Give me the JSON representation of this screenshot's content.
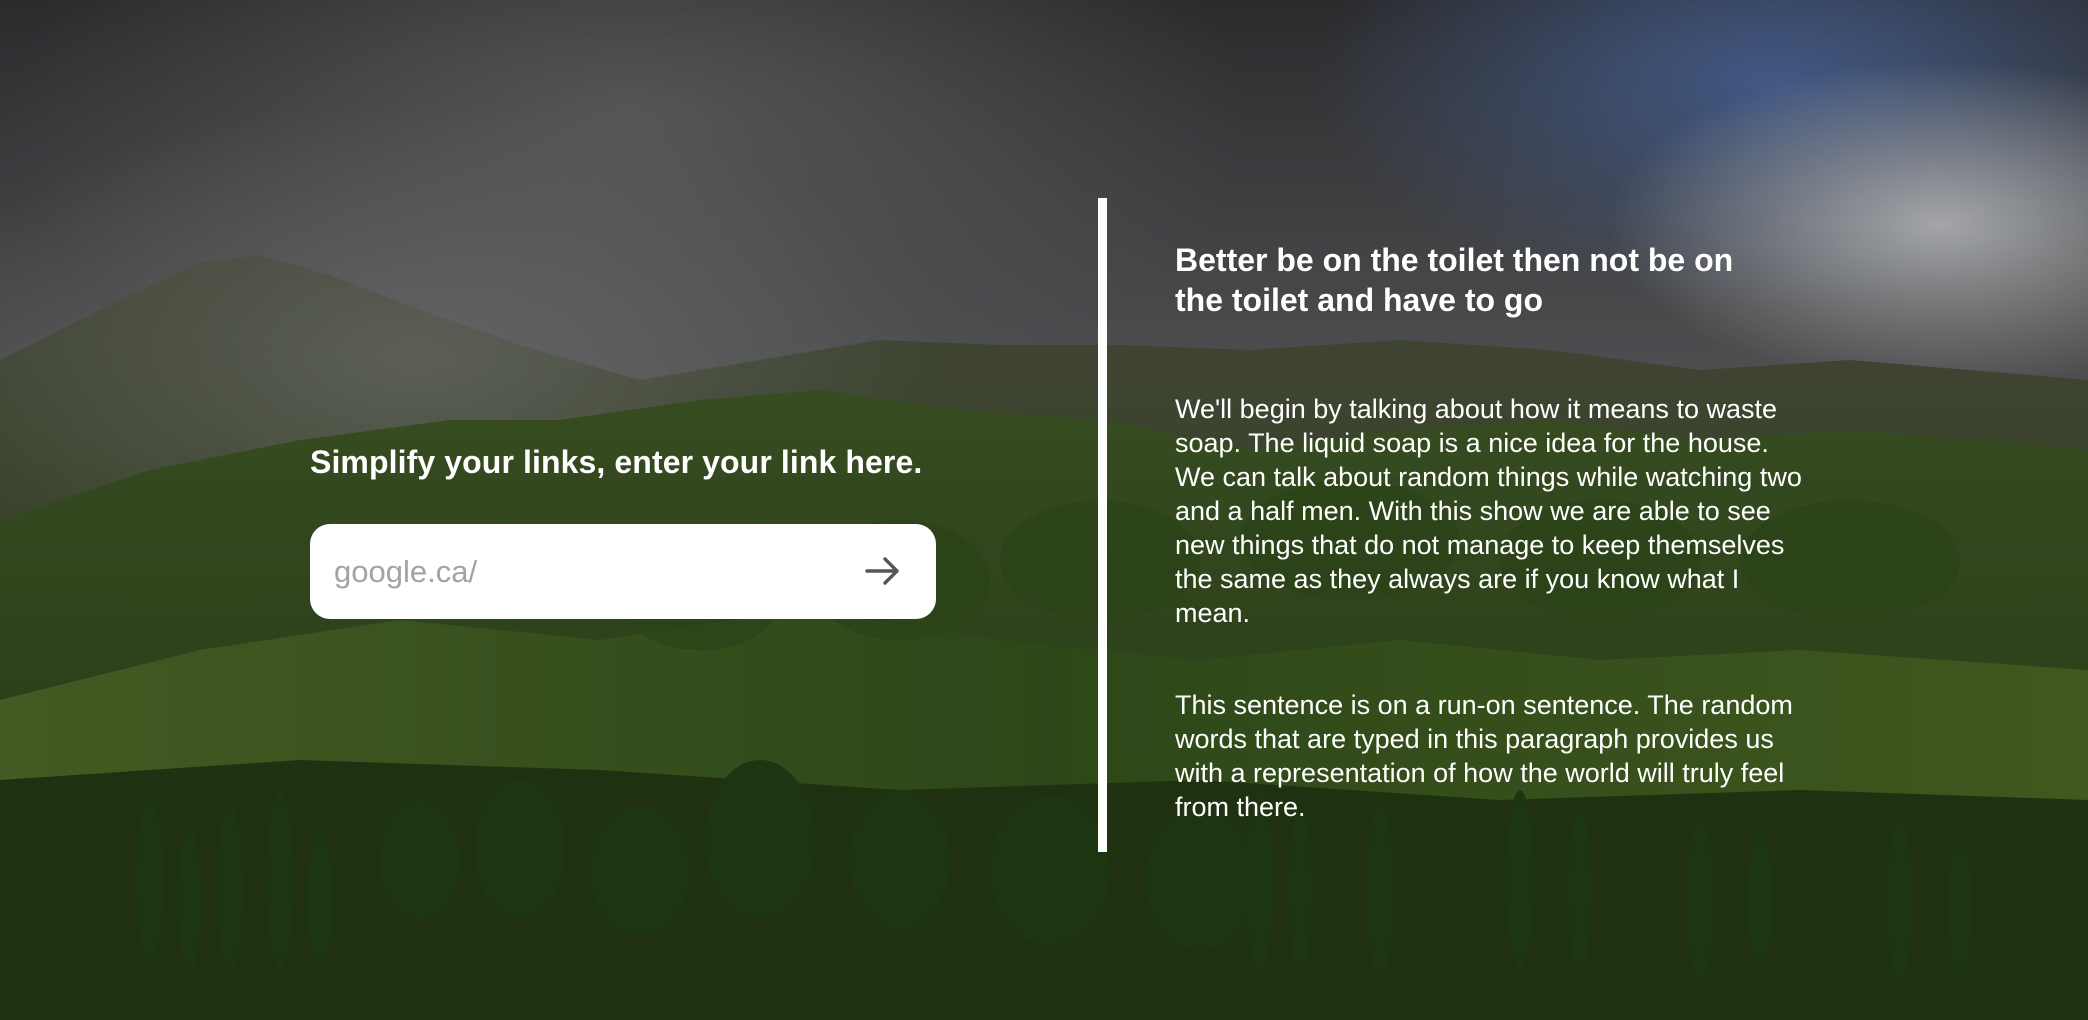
{
  "background": {
    "scene": "mountain-valley-landscape"
  },
  "shortener": {
    "heading": "Simplify your links, enter your link here.",
    "input_placeholder": "google.ca/",
    "submit_icon": "arrow-right-icon"
  },
  "article": {
    "heading": "Better be on the toilet then not be on the toilet and have to go",
    "paragraphs": [
      "We'll begin by talking about how it means to waste soap. The liquid soap is a nice idea for the house. We can talk about random things while watching two and a half men. With this show we are able to see new things that do not manage to keep themselves the same as they always are if you know what I mean.",
      "This sentence is on a run-on sentence. The random words that are typed in this paragraph provides us with a representation of how the world will truly feel from there."
    ]
  },
  "colors": {
    "text": "#ffffff",
    "input_background": "#ffffff",
    "placeholder": "#a3a3a3",
    "icon": "#555555",
    "divider": "#ffffff"
  }
}
